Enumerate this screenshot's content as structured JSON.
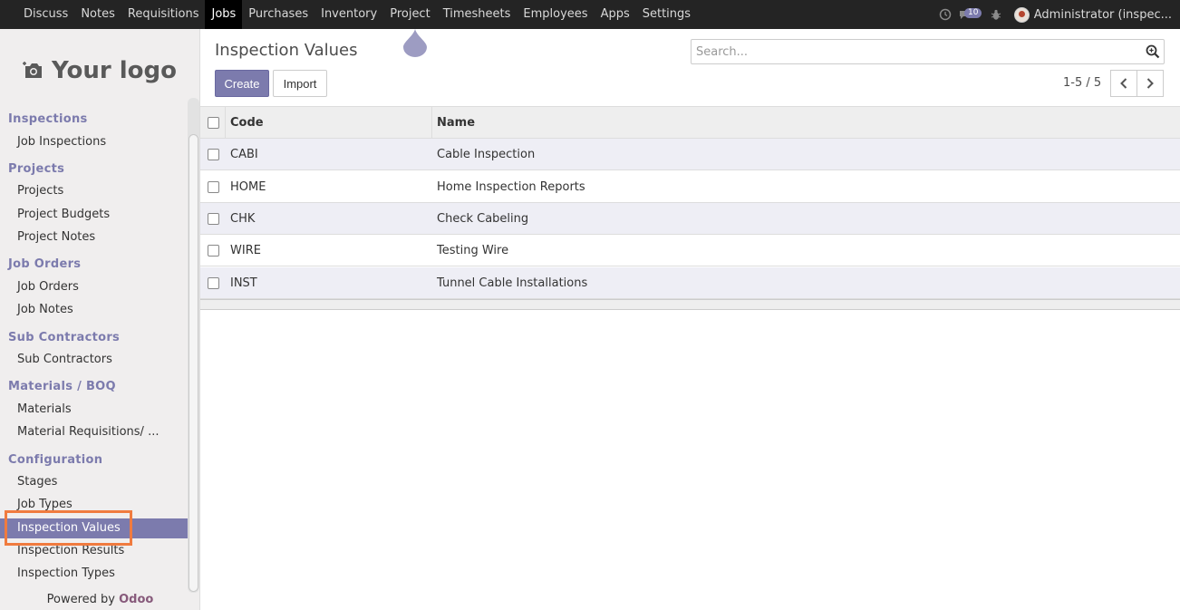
{
  "topbar": {
    "menu": [
      "Discuss",
      "Notes",
      "Requisitions",
      "Jobs",
      "Purchases",
      "Inventory",
      "Project",
      "Timesheets",
      "Employees",
      "Apps",
      "Settings"
    ],
    "active": "Jobs",
    "message_count": "10",
    "user": "Administrator (inspec..."
  },
  "sidebar": {
    "logo": "Your logo",
    "sections": {
      "inspections": "Inspections",
      "projects": "Projects",
      "job_orders": "Job Orders",
      "sub_contractors": "Sub Contractors",
      "materials": "Materials  /  BOQ",
      "configuration": "Configuration"
    },
    "items": {
      "job_inspections": "Job Inspections",
      "projects": "Projects",
      "project_budgets": "Project Budgets",
      "project_notes": "Project Notes",
      "job_orders": "Job Orders",
      "job_notes": "Job Notes",
      "sub_contractors": "Sub Contractors",
      "materials": "Materials",
      "material_requisitions": "Material Requisitions/ ...",
      "stages": "Stages",
      "job_types": "Job Types",
      "inspection_values": "Inspection Values",
      "inspection_results": "Inspection Results",
      "inspection_types": "Inspection Types"
    },
    "powered_by": "Powered by",
    "odoo": "Odoo"
  },
  "control": {
    "title": "Inspection Values",
    "create": "Create",
    "import": "Import",
    "search_placeholder": "Search...",
    "pager": "1-5 / 5"
  },
  "table": {
    "headers": {
      "code": "Code",
      "name": "Name"
    },
    "rows": [
      {
        "code": "CABI",
        "name": "Cable Inspection"
      },
      {
        "code": "HOME",
        "name": "Home Inspection Reports"
      },
      {
        "code": "CHK",
        "name": "Check Cabeling"
      },
      {
        "code": "WIRE",
        "name": "Testing Wire"
      },
      {
        "code": "INST",
        "name": "Tunnel Cable Installations"
      }
    ]
  },
  "colors": {
    "accent": "#7c7bad",
    "highlight": "#f07b3f",
    "topbar": "#242424"
  }
}
